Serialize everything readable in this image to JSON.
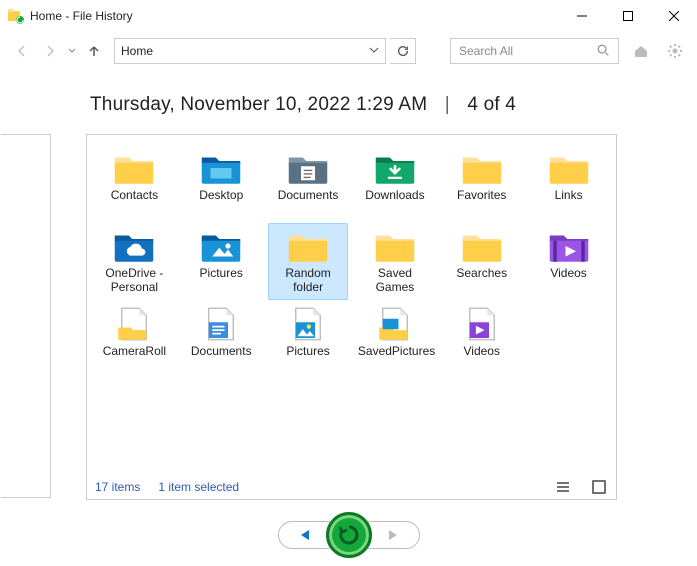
{
  "window": {
    "title": "Home - File History"
  },
  "nav": {
    "breadcrumb": "Home",
    "search_placeholder": "Search All"
  },
  "header": {
    "datetime": "Thursday, November 10, 2022 1:29 AM",
    "position": "4 of 4"
  },
  "items": {
    "row1": [
      {
        "label": "Contacts",
        "icon": "folder-yellow"
      },
      {
        "label": "Desktop",
        "icon": "folder-desktop"
      },
      {
        "label": "Documents",
        "icon": "folder-documents"
      },
      {
        "label": "Downloads",
        "icon": "folder-downloads"
      },
      {
        "label": "Favorites",
        "icon": "folder-yellow"
      },
      {
        "label": "Links",
        "icon": "folder-yellow"
      }
    ],
    "row2": [
      {
        "label": "OneDrive - Personal",
        "icon": "folder-onedrive"
      },
      {
        "label": "Pictures",
        "icon": "folder-pictures"
      },
      {
        "label": "Random folder",
        "icon": "folder-yellow",
        "selected": true
      },
      {
        "label": "Saved Games",
        "icon": "folder-yellow"
      },
      {
        "label": "Searches",
        "icon": "folder-yellow"
      },
      {
        "label": "Videos",
        "icon": "folder-videos"
      }
    ],
    "row3": [
      {
        "label": "CameraRoll",
        "icon": "lib-camera"
      },
      {
        "label": "Documents",
        "icon": "lib-documents"
      },
      {
        "label": "Pictures",
        "icon": "lib-pictures"
      },
      {
        "label": "SavedPictures",
        "icon": "lib-saved"
      },
      {
        "label": "Videos",
        "icon": "lib-videos"
      }
    ]
  },
  "status": {
    "count": "17 items",
    "selection": "1 item selected"
  }
}
